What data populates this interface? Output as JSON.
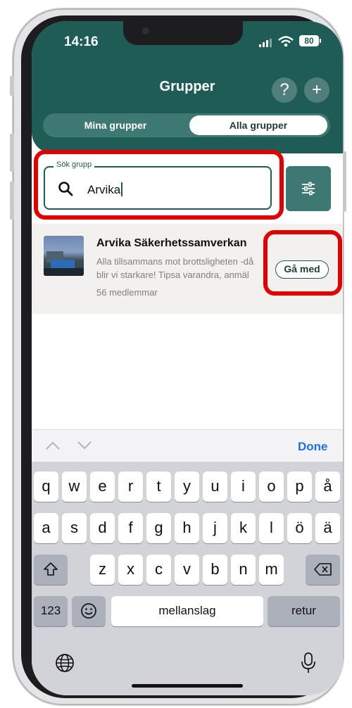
{
  "status_bar": {
    "time": "14:16",
    "battery": "80"
  },
  "header": {
    "title": "Grupper",
    "help_label": "?",
    "add_label": "+"
  },
  "tabs": [
    {
      "label": "Mina grupper",
      "selected": false
    },
    {
      "label": "Alla grupper",
      "selected": true
    }
  ],
  "search": {
    "legend": "Sök grupp",
    "value": "Arvika"
  },
  "result": {
    "name": "Arvika Säkerhetssamverkan",
    "desc_line1": "Alla tillsammans mot brottsligheten -då",
    "desc_line2": "blir vi starkare! Tipsa varandra, anmäl",
    "members": "56 medlemmar",
    "join_label": "Gå med"
  },
  "keyboard": {
    "done_label": "Done",
    "row1": [
      "q",
      "w",
      "e",
      "r",
      "t",
      "y",
      "u",
      "i",
      "o",
      "p",
      "å"
    ],
    "row2": [
      "a",
      "s",
      "d",
      "f",
      "g",
      "h",
      "j",
      "k",
      "l",
      "ö",
      "ä"
    ],
    "row3": [
      "z",
      "x",
      "c",
      "v",
      "b",
      "n",
      "m"
    ],
    "numbers_label": "123",
    "space_label": "mellanslag",
    "return_label": "retur"
  },
  "colors": {
    "brand": "#1f5c56",
    "accent_blue": "#1a73e8",
    "highlight": "#e00000"
  }
}
